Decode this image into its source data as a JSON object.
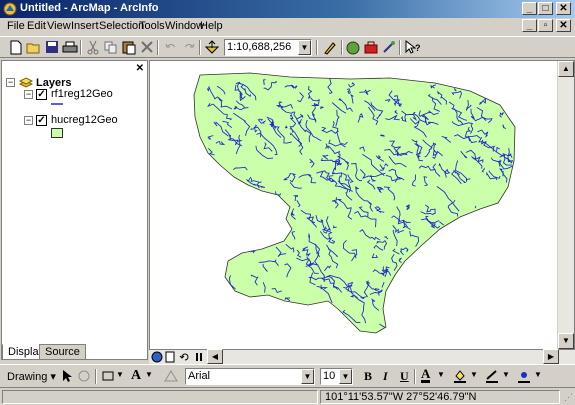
{
  "window": {
    "title": "Untitled - ArcMap - ArcInfo"
  },
  "menu": [
    "File",
    "Edit",
    "View",
    "Insert",
    "Selection",
    "Tools",
    "Window",
    "Help"
  ],
  "menu_underline": [
    "F",
    "E",
    "V",
    "I",
    "S",
    "T",
    "W",
    "H"
  ],
  "toolbar": {
    "scale": "1:10,688,256"
  },
  "toc": {
    "root_label": "Layers",
    "layers": [
      {
        "name": "rf1reg12Geo",
        "checked": true,
        "symbol": "line"
      },
      {
        "name": "hucreg12Geo",
        "checked": true,
        "symbol": "polygon"
      }
    ],
    "tabs": {
      "display": "Display",
      "source": "Source"
    }
  },
  "drawing_toolbar": {
    "drawing_label": "Drawing",
    "font": "Arial",
    "font_size": "10",
    "bold": "B",
    "italic": "I",
    "underline": "U",
    "text_tool": "A"
  },
  "status": {
    "coordinates": "101°11'53.57\"W  27°52'46.79\"N"
  },
  "colors": {
    "title_start": "#0a246a",
    "title_end": "#a6caf0",
    "map_fill": "#ccffaa",
    "river": "#1c2ec8",
    "polygon_outline": "#303030"
  }
}
